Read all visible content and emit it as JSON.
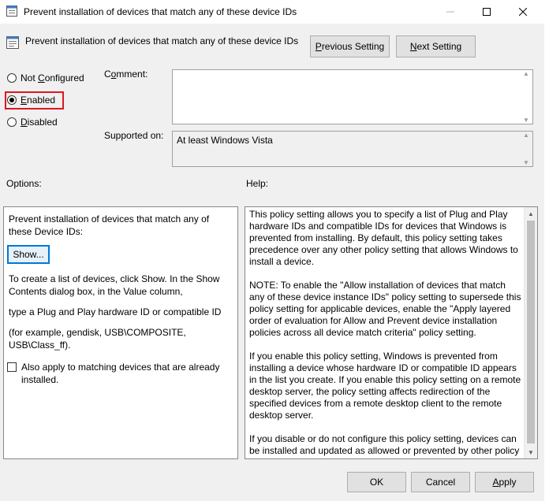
{
  "window": {
    "title": "Prevent installation of devices that match any of these device IDs",
    "icon": "policy-settings-icon",
    "controls": {
      "minimize": "minimize-icon",
      "maximize": "maximize-icon",
      "close": "close-icon"
    }
  },
  "header": {
    "policy_name": "Prevent installation of devices that match  any of these device IDs",
    "prev_button": {
      "pre": "",
      "accel": "P",
      "post": "revious Setting"
    },
    "next_button": {
      "pre": "",
      "accel": "N",
      "post": "ext Setting"
    }
  },
  "state": {
    "options": [
      {
        "pre": "Not ",
        "accel": "C",
        "post": "onfigured",
        "checked": false
      },
      {
        "pre": "",
        "accel": "E",
        "post": "nabled",
        "checked": true
      },
      {
        "pre": "",
        "accel": "D",
        "post": "isabled",
        "checked": false
      }
    ],
    "highlight_color": "#e0161f"
  },
  "comment": {
    "label_pre": "C",
    "label_accel": "o",
    "label_post": "mment:",
    "value": ""
  },
  "supported": {
    "label": "Supported on:",
    "value": "At least Windows Vista"
  },
  "options_section": {
    "label": "Options:",
    "intro": "Prevent installation of devices that match any of these Device IDs:",
    "show_button": "Show...",
    "line1": "To create a list of devices, click Show. In the Show Contents dialog box, in the Value column,",
    "line2": "type a Plug and Play hardware ID or compatible ID",
    "line3": "(for example, gendisk, USB\\COMPOSITE, USB\\Class_ff).",
    "checkbox_label": "Also apply to matching devices that are already installed.",
    "checkbox_checked": false
  },
  "help_section": {
    "label": "Help:",
    "paragraphs": [
      "This policy setting allows you to specify a list of Plug and Play hardware IDs and compatible IDs for devices that Windows is prevented from installing. By default, this policy setting takes precedence over any other policy setting that allows Windows to install a device.",
      "NOTE: To enable the \"Allow installation of devices that match any of these device instance IDs\" policy setting to supersede this policy setting for applicable devices, enable the \"Apply layered order of evaluation for Allow and Prevent device installation policies across all device match criteria\" policy setting.",
      "If you enable this policy setting, Windows is prevented from installing a device whose hardware ID or compatible ID appears in the list you create. If you enable this policy setting on a remote desktop server, the policy setting affects redirection of the specified devices from a remote desktop client to the remote desktop server.",
      "If you disable or do not configure this policy setting, devices can be installed and updated as allowed or prevented by other policy settings."
    ]
  },
  "footer": {
    "ok": "OK",
    "cancel": "Cancel",
    "apply_pre": "",
    "apply_accel": "A",
    "apply_post": "pply"
  }
}
